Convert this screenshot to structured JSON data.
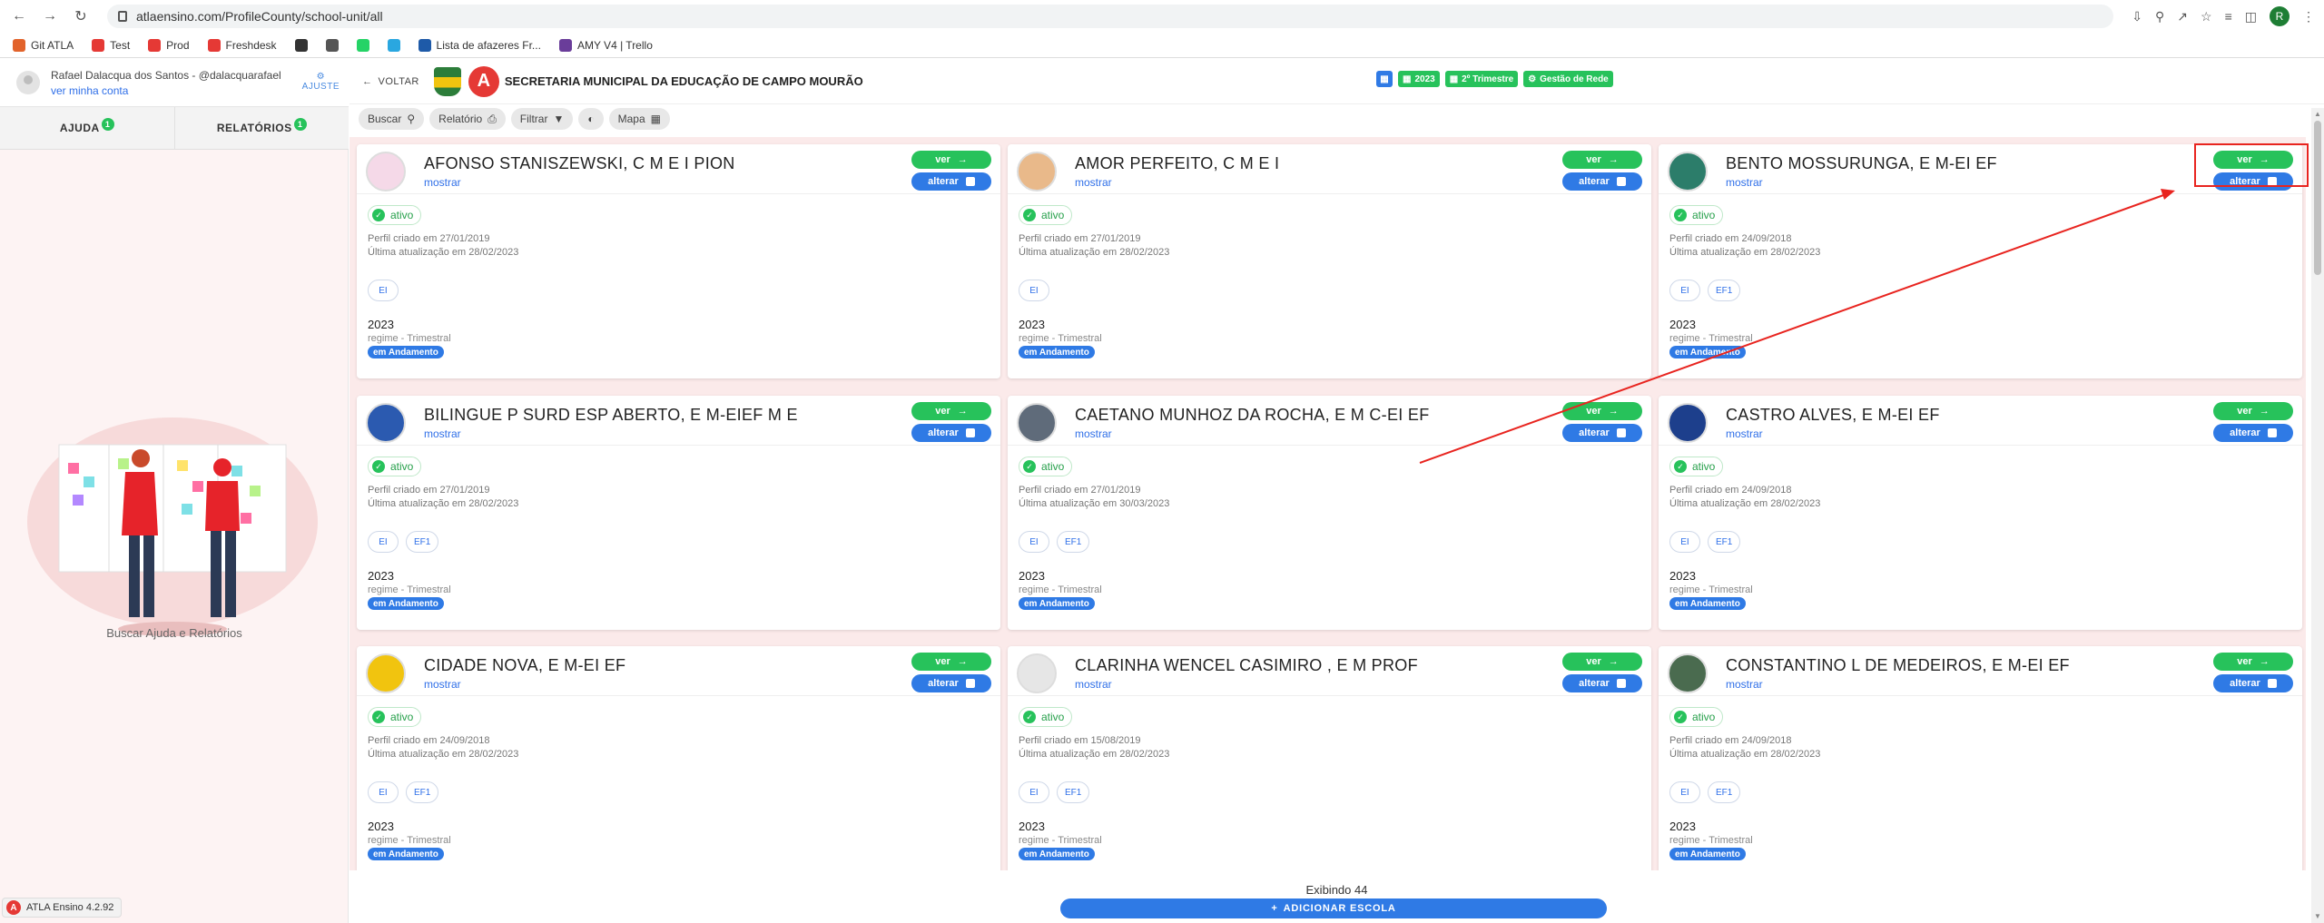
{
  "browser": {
    "url": "atlaensino.com/ProfileCounty/school-unit/all",
    "avatar_letter": "R",
    "bookmarks": [
      {
        "label": "Git ATLA",
        "color": "#e2632b"
      },
      {
        "label": "Test",
        "color": "#e53935"
      },
      {
        "label": "Prod",
        "color": "#e53935"
      },
      {
        "label": "Freshdesk",
        "color": "#e53935"
      },
      {
        "label": "",
        "color": "#333333"
      },
      {
        "label": "",
        "color": "#555555"
      },
      {
        "label": "",
        "color": "#25d366"
      },
      {
        "label": "",
        "color": "#2aa7e0"
      },
      {
        "label": "Lista de afazeres Fr...",
        "color": "#1e5aa8"
      },
      {
        "label": "AMY V4 | Trello",
        "color": "#6a3d9a"
      }
    ]
  },
  "sidebar": {
    "user_name": "Rafael Dalacqua dos Santos - @dalacquarafael",
    "user_link": "ver minha conta",
    "ajuste_label": "AJUSTE",
    "tabs": [
      {
        "label": "AJUDA",
        "badge": "1"
      },
      {
        "label": "RELATÓRIOS",
        "badge": "1"
      }
    ],
    "help_caption": "Buscar Ajuda e Relatórios",
    "version": "ATLA Ensino 4.2.92"
  },
  "header": {
    "back_label": "VOLTAR",
    "org_title": "SECRETARIA MUNICIPAL DA EDUCAÇÃO DE CAMPO MOURÃO",
    "chips": [
      "2023",
      "2º Trimestre",
      "Gestão de Rede"
    ]
  },
  "toolbar": {
    "buttons": [
      "Buscar",
      "Relatório",
      "Filtrar",
      "",
      "Mapa"
    ]
  },
  "labels": {
    "ver": "ver",
    "alterar": "alterar",
    "mostrar": "mostrar",
    "status": "ativo",
    "year": "2023",
    "regime": "regime - Trimestral",
    "state": "em Andamento"
  },
  "schools": [
    {
      "name": "AFONSO STANISZEWSKI, C M E I PION",
      "created": "Perfil criado em 27/01/2019",
      "updated": "Última atualização em 28/02/2023",
      "levels": [
        "EI"
      ],
      "logo_color": "#f5d9e8"
    },
    {
      "name": "AMOR PERFEITO, C M E I",
      "created": "Perfil criado em 27/01/2019",
      "updated": "Última atualização em 28/02/2023",
      "levels": [
        "EI"
      ],
      "logo_color": "#e9b98a"
    },
    {
      "name": "BENTO MOSSURUNGA, E M-EI EF",
      "created": "Perfil criado em 24/09/2018",
      "updated": "Última atualização em 28/02/2023",
      "levels": [
        "EI",
        "EF1"
      ],
      "logo_color": "#2c7d6a"
    },
    {
      "name": "BILINGUE P SURD ESP ABERTO, E M-EIEF M E",
      "created": "Perfil criado em 27/01/2019",
      "updated": "Última atualização em 28/02/2023",
      "levels": [
        "EI",
        "EF1"
      ],
      "logo_color": "#2b5ab0"
    },
    {
      "name": "CAETANO MUNHOZ DA ROCHA, E M C-EI EF",
      "created": "Perfil criado em 27/01/2019",
      "updated": "Última atualização em 30/03/2023",
      "levels": [
        "EI",
        "EF1"
      ],
      "logo_color": "#5f6b7a"
    },
    {
      "name": "CASTRO ALVES, E M-EI EF",
      "created": "Perfil criado em 24/09/2018",
      "updated": "Última atualização em 28/02/2023",
      "levels": [
        "EI",
        "EF1"
      ],
      "logo_color": "#1d3f8c"
    },
    {
      "name": "CIDADE NOVA, E M-EI EF",
      "created": "Perfil criado em 24/09/2018",
      "updated": "Última atualização em 28/02/2023",
      "levels": [
        "EI",
        "EF1"
      ],
      "logo_color": "#f1c40f"
    },
    {
      "name": "CLARINHA WENCEL CASIMIRO , E M PROF",
      "created": "Perfil criado em 15/08/2019",
      "updated": "Última atualização em 28/02/2023",
      "levels": [
        "EI",
        "EF1"
      ],
      "logo_color": "#e6e6e6"
    },
    {
      "name": "CONSTANTINO L DE MEDEIROS, E M-EI EF",
      "created": "Perfil criado em 24/09/2018",
      "updated": "Última atualização em 28/02/2023",
      "levels": [
        "EI",
        "EF1"
      ],
      "logo_color": "#4a6b4f"
    }
  ],
  "footer": {
    "count_text": "Exibindo 44",
    "add_label": "ADICIONAR ESCOLA"
  }
}
